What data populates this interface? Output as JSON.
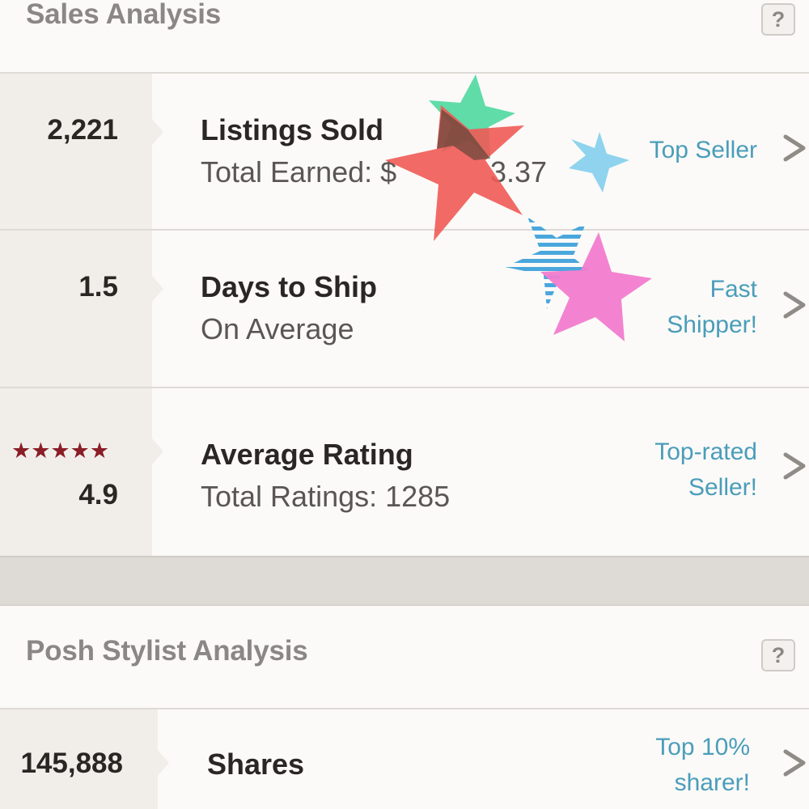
{
  "sales_section": {
    "title": "Sales Analysis",
    "help_label": "?",
    "rows": [
      {
        "stat": "2,221",
        "primary": "Listings Sold",
        "secondary": "Total Earned: $",
        "secondary_suffix": "3.37",
        "badge_lines": [
          "Top Seller"
        ]
      },
      {
        "stat": "1.5",
        "primary": "Days to Ship",
        "secondary": "On Average",
        "badge_lines": [
          "Fast",
          "Shipper!"
        ]
      },
      {
        "stat": "4.9",
        "stars": "★★★★★",
        "primary": "Average Rating",
        "secondary": "Total Ratings: 1285",
        "badge_lines": [
          "Top-rated",
          "Seller!"
        ]
      }
    ]
  },
  "stylist_section": {
    "title": "Posh Stylist Analysis",
    "help_label": "?",
    "rows": [
      {
        "stat": "145,888",
        "primary": "Shares",
        "badge_lines": [
          "Top 10%",
          "sharer!"
        ]
      }
    ]
  },
  "colors": {
    "accent_blue": "#4a9dba",
    "star_rating": "#8a1d26",
    "sticker_green": "#4fd8a0",
    "sticker_red": "#f05a55",
    "sticker_light_blue": "#8fd3ee",
    "sticker_striped_blue": "#4aa7dd",
    "sticker_pink": "#f27ccf"
  },
  "icons": {
    "help": "question-mark-icon",
    "chevron": "chevron-right-icon",
    "sticker": "star-sticker-icon"
  }
}
